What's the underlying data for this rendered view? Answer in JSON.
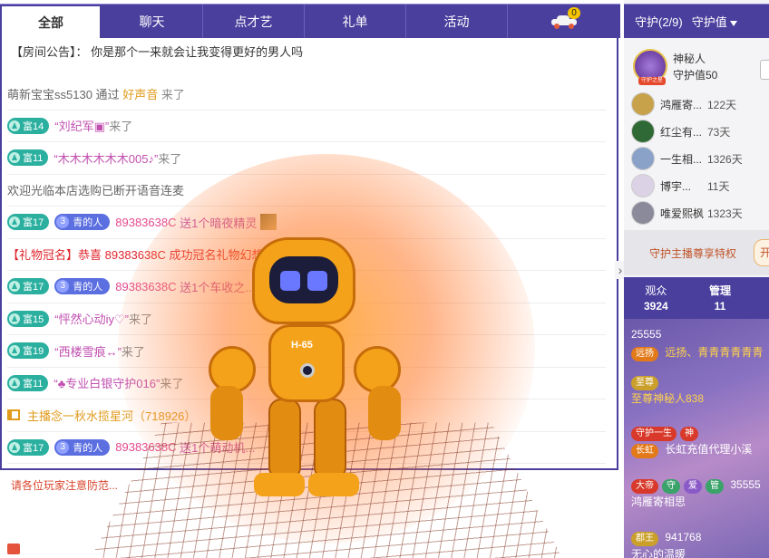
{
  "tabs": {
    "items": [
      "全部",
      "聊天",
      "点才艺",
      "礼单",
      "活动"
    ],
    "car_badge": "0"
  },
  "notice": {
    "label": "【房间公告】：",
    "text": "你是那个一来就会让我变得更好的男人吗"
  },
  "chat": [
    {
      "kind": "join",
      "user": "萌新宝宝ss5130",
      "via": "通过",
      "via_name": "好声音",
      "suffix": "来了"
    },
    {
      "kind": "rich_join",
      "rich": "富14",
      "name": "“刘纪军▣”",
      "suffix": "来了"
    },
    {
      "kind": "rich_join",
      "rich": "富11",
      "name": "“木木木木木木005♪”",
      "suffix": "来了"
    },
    {
      "kind": "system",
      "text": "欢迎光临本店选购已断开语音连麦"
    },
    {
      "kind": "gift",
      "rich": "富17",
      "level": "3",
      "level_label": "青的人",
      "uid": "89383638C",
      "text": "送1个暗夜精灵"
    },
    {
      "kind": "crown",
      "prefix": "【礼物冠名】",
      "text": "恭喜 89383638C 成功冠名礼物幻想魔..."
    },
    {
      "kind": "gift",
      "rich": "富17",
      "level": "3",
      "level_label": "青的人",
      "uid": "89383638C",
      "text": "送1个车收之..."
    },
    {
      "kind": "rich_join",
      "rich": "富15",
      "name": "“怦然心动iy♡”",
      "suffix": "来了"
    },
    {
      "kind": "rich_join",
      "rich": "富19",
      "name": "“西楼雪痕↔”",
      "suffix": "来了"
    },
    {
      "kind": "rich_join",
      "rich": "富11",
      "name": "“♣专业白银守护016”",
      "suffix": "来了"
    },
    {
      "kind": "broadcast",
      "text": "主播念一秋水揽星河（718926）"
    },
    {
      "kind": "gift",
      "rich": "富17",
      "level": "3",
      "level_label": "青的人",
      "uid": "89383638C",
      "text": "送1个萌动机..."
    }
  ],
  "warning": "请各位玩家注意防范...",
  "robot_label": "H-65",
  "guard": {
    "title": "守护(2/9)",
    "sort_label": "守护值",
    "top": {
      "name": "神秘人",
      "value_label": "守护值50",
      "avatar_tag": "守护之星"
    },
    "list": [
      {
        "name": "鸿雁寄...",
        "days": "122天",
        "color": "#c7a24a"
      },
      {
        "name": "红尘有...",
        "days": "73天",
        "color": "#2f6a36"
      },
      {
        "name": "一生相...",
        "days": "1326天",
        "color": "#8aa2c8"
      },
      {
        "name": "博宇...",
        "days": "11天",
        "color": "#dcd2e6"
      },
      {
        "name": "唯爱熙枫",
        "days": "1323天",
        "color": "#8a8a9a"
      }
    ],
    "privilege": "守护主播尊享特权",
    "privilege_btn": "开"
  },
  "stats": {
    "audience_label": "观众",
    "audience_count": "3924",
    "admin_label": "管理",
    "admin_count": "11"
  },
  "audience": [
    {
      "badge": "远扬",
      "id": "25555",
      "name": "远扬、青青青青青青"
    },
    {
      "badge": "至尊",
      "name": "至尊神秘人838"
    },
    {
      "badge": "守护一生",
      "badge2": "神",
      "badge3": "长虹",
      "name": "长虹充值代理小溪"
    },
    {
      "badge": "大帝",
      "badge2": "守",
      "badge3": "爱",
      "badge4": "管",
      "id": "35555",
      "name": "鸿雁寄相思"
    },
    {
      "badge": "郡王",
      "id": "941768",
      "name": "无心的温暖"
    }
  ],
  "colors": {
    "accent": "#4b3f9e",
    "rich_badge": "#2bb0a0",
    "level_badge": "#5b6fe0",
    "warning": "#d9452e"
  }
}
